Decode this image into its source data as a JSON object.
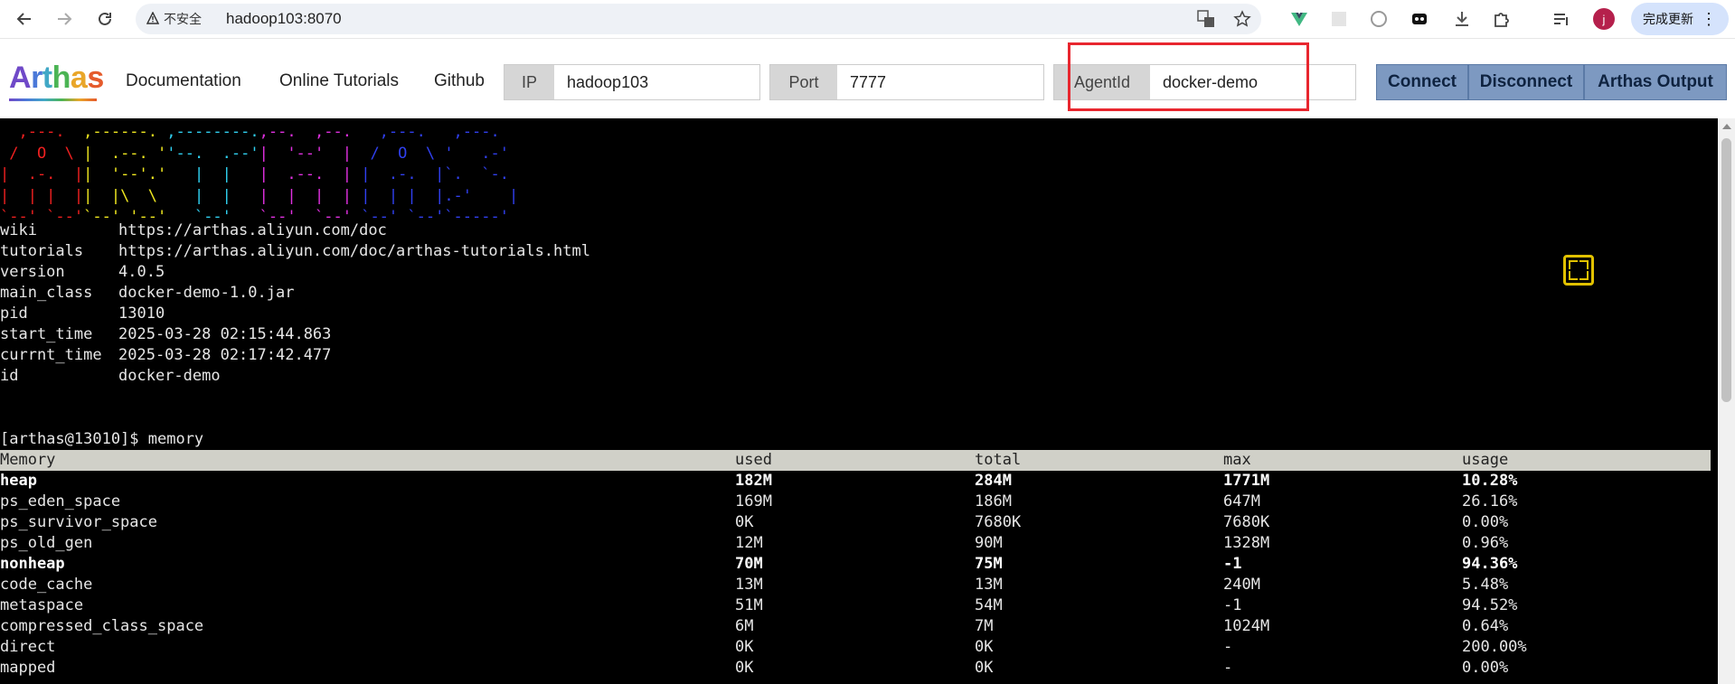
{
  "browser": {
    "security_label": "不安全",
    "url": "hadoop103:8070",
    "profile_initial": "j",
    "update_label": "完成更新"
  },
  "header": {
    "logo": [
      "A",
      "r",
      "t",
      "h",
      "a",
      "s"
    ],
    "nav": [
      "Documentation",
      "Online Tutorials",
      "Github"
    ],
    "ip_label": "IP",
    "ip_value": "hadoop103",
    "port_label": "Port",
    "port_value": "7777",
    "agent_label": "AgentId",
    "agent_value": "docker-demo",
    "buttons": [
      "Connect",
      "Disconnect",
      "Arthas Output"
    ]
  },
  "terminal": {
    "banner_info": [
      {
        "key": "wiki",
        "value": "https://arthas.aliyun.com/doc"
      },
      {
        "key": "tutorials",
        "value": "https://arthas.aliyun.com/doc/arthas-tutorials.html"
      },
      {
        "key": "version",
        "value": "4.0.5"
      },
      {
        "key": "main_class",
        "value": "docker-demo-1.0.jar"
      },
      {
        "key": "pid",
        "value": "13010"
      },
      {
        "key": "start_time",
        "value": "2025-03-28 02:15:44.863"
      },
      {
        "key": "currnt_time",
        "value": "2025-03-28 02:17:42.477"
      },
      {
        "key": "id",
        "value": "docker-demo"
      }
    ],
    "prompt": "[arthas@13010]$ memory",
    "memory_headers": [
      "Memory",
      "used",
      "total",
      "max",
      "usage"
    ],
    "memory_rows": [
      {
        "name": "heap",
        "used": "182M",
        "total": "284M",
        "max": "1771M",
        "usage": "10.28%",
        "bold": true
      },
      {
        "name": "ps_eden_space",
        "used": "169M",
        "total": "186M",
        "max": "647M",
        "usage": "26.16%",
        "bold": false
      },
      {
        "name": "ps_survivor_space",
        "used": "0K",
        "total": "7680K",
        "max": "7680K",
        "usage": "0.00%",
        "bold": false
      },
      {
        "name": "ps_old_gen",
        "used": "12M",
        "total": "90M",
        "max": "1328M",
        "usage": "0.96%",
        "bold": false
      },
      {
        "name": "nonheap",
        "used": "70M",
        "total": "75M",
        "max": "-1",
        "usage": "94.36%",
        "bold": true
      },
      {
        "name": "code_cache",
        "used": "13M",
        "total": "13M",
        "max": "240M",
        "usage": "5.48%",
        "bold": false
      },
      {
        "name": "metaspace",
        "used": "51M",
        "total": "54M",
        "max": "-1",
        "usage": "94.52%",
        "bold": false
      },
      {
        "name": "compressed_class_space",
        "used": "6M",
        "total": "7M",
        "max": "1024M",
        "usage": "0.64%",
        "bold": false
      },
      {
        "name": "direct",
        "used": "0K",
        "total": "0K",
        "max": "-",
        "usage": "200.00%",
        "bold": false
      },
      {
        "name": "mapped",
        "used": "0K",
        "total": "0K",
        "max": "-",
        "usage": "0.00%",
        "bold": false
      }
    ]
  },
  "icons": {
    "back": "back-arrow-icon",
    "forward": "forward-arrow-icon",
    "reload": "reload-icon",
    "warning": "warning-icon",
    "translate": "translate-icon",
    "star": "bookmark-star-icon",
    "fullscreen": "fullscreen-icon"
  }
}
